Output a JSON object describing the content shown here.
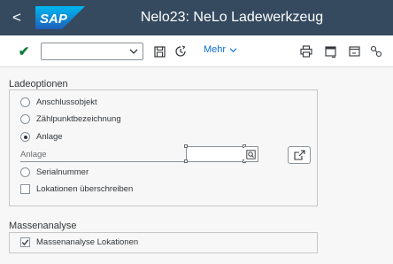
{
  "header": {
    "back_glyph": "<",
    "logo_text": "SAP",
    "title": "Nelo23: NeLo Ladewerkzeug",
    "bg_color": "#354a5f"
  },
  "toolbar": {
    "command_field": {
      "value": "",
      "placeholder": ""
    },
    "mehr_label": "Mehr",
    "icons": [
      "checkmark-icon",
      "chevron-down-icon",
      "save-icon",
      "clock-icon",
      "print-icon",
      "window-icon",
      "window-icon",
      "settings-icon"
    ]
  },
  "ladeoptionen": {
    "title": "Ladeoptionen",
    "options": [
      {
        "label": "Anschlussobjekt",
        "selected": false
      },
      {
        "label": "Zählpunktbezeichnung",
        "selected": false
      },
      {
        "label": "Anlage",
        "selected": true
      }
    ],
    "anlage_field": {
      "label": "Anlage",
      "value": ""
    },
    "serialnummer_label": "Serialnummer",
    "overwrite_checkbox": {
      "label": "Lokationen überschreiben",
      "checked": false
    }
  },
  "massenanalyse": {
    "title": "Massenanalyse",
    "checkbox": {
      "label": "Massenanalyse Lokationen",
      "checked": true
    }
  }
}
